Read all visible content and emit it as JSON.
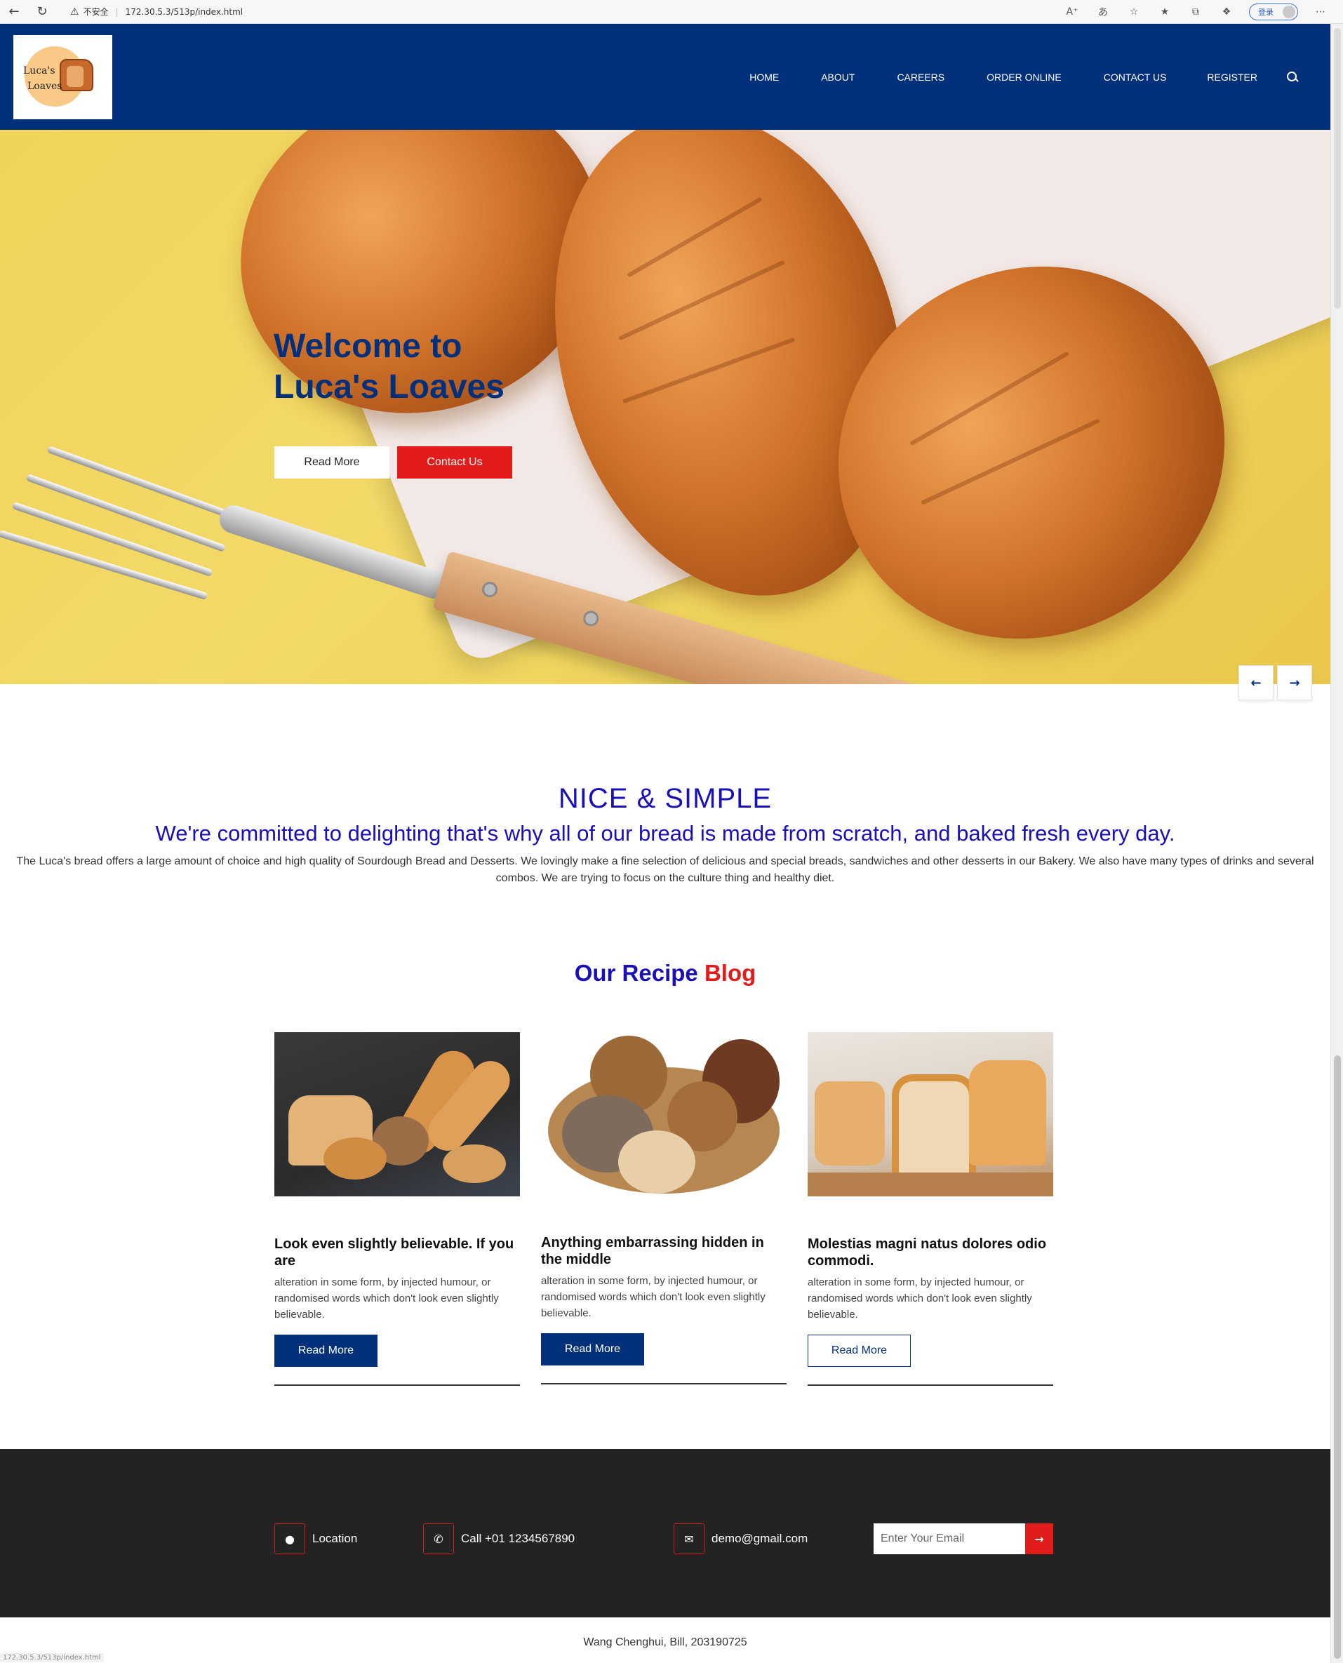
{
  "browser": {
    "security_label": "不安全",
    "url": "172.30.5.3/513p/index.html",
    "login_label": "登录"
  },
  "header": {
    "logo_line1": "Luca's",
    "logo_line2": "Loaves",
    "nav": [
      "HOME",
      "ABOUT",
      "CAREERS",
      "ORDER ONLINE",
      "CONTACT US",
      "REGISTER"
    ]
  },
  "hero": {
    "title": "Welcome to Luca's Loaves",
    "read_more": "Read More",
    "contact_us": "Contact Us"
  },
  "about": {
    "heading": "NICE & SIMPLE",
    "subheading": "We're committed to delighting that's why all of our bread is made from scratch, and baked fresh every day.",
    "body": "The Luca's bread offers a large amount of choice and high quality of Sourdough Bread and Desserts. We lovingly make a fine selection of delicious and special breads, sandwiches and other desserts in our Bakery. We also have many types of drinks and several combos. We are trying to focus on the culture thing and healthy diet."
  },
  "blog": {
    "title_part1": "Our Recipe",
    "title_part2": "Blog",
    "cards": [
      {
        "title": "Look even slightly believable. If you are",
        "text": "alteration in some form, by injected humour, or randomised words which don't look even slightly believable.",
        "button": "Read More"
      },
      {
        "title": "Anything embarrassing hidden in the middle",
        "text": "alteration in some form, by injected humour, or randomised words which don't look even slightly believable.",
        "button": "Read More"
      },
      {
        "title": "Molestias magni natus dolores odio commodi.",
        "text": "alteration in some form, by injected humour, or randomised words which don't look even slightly believable.",
        "button": "Read More"
      }
    ]
  },
  "footer": {
    "location": "Location",
    "phone": "Call +01 1234567890",
    "email": "demo@gmail.com",
    "email_placeholder": "Enter Your Email",
    "copyright": "Wang Chenghui, Bill, 203190725"
  },
  "colors": {
    "brand_navy": "#02307a",
    "accent_red": "#e21b1b",
    "heading_blue": "#1a10b8",
    "footer_dark": "#232323"
  },
  "icons": {
    "nav_search": "search-icon",
    "prev": "arrow-left-icon",
    "next": "arrow-right-icon",
    "location": "map-marker-icon",
    "phone": "phone-icon",
    "email": "envelope-icon",
    "submit": "arrow-right-icon"
  }
}
